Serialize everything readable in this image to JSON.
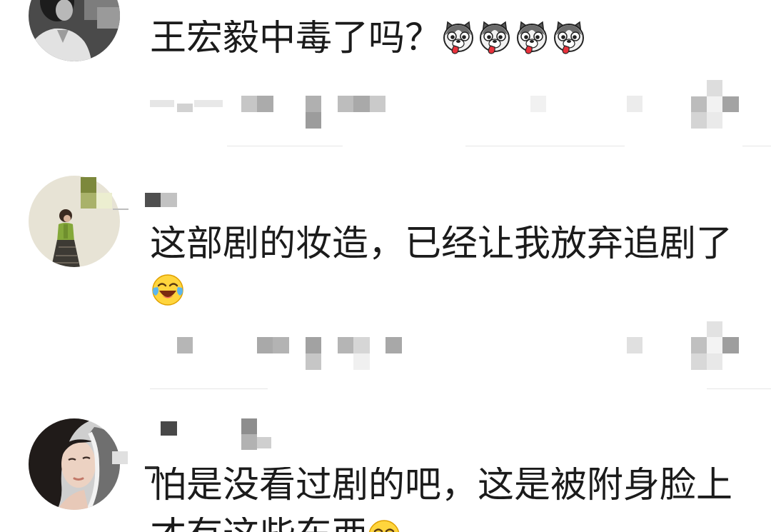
{
  "colors": {
    "background": "#ffffff",
    "text": "#1b1b1b",
    "divider": "#e6e6e6"
  },
  "comments": [
    {
      "avatar": "avatar-photo",
      "lines": [
        "王宏毅中毒了吗？"
      ],
      "emojis": [
        "husky-emoji-icon",
        "husky-emoji-icon",
        "husky-emoji-icon",
        "husky-emoji-icon"
      ]
    },
    {
      "avatar": "avatar-photo",
      "lines": [
        "这部剧的妆造，已经让我放弃追剧了"
      ],
      "emojis": [
        "laugh-cry-emoji-icon"
      ]
    },
    {
      "avatar": "avatar-photo",
      "lines": [
        "怕是没看过剧的吧，这是被附身脸上",
        "才有这些东西"
      ],
      "emojis": [
        "laugh-cry-emoji-icon"
      ]
    }
  ]
}
